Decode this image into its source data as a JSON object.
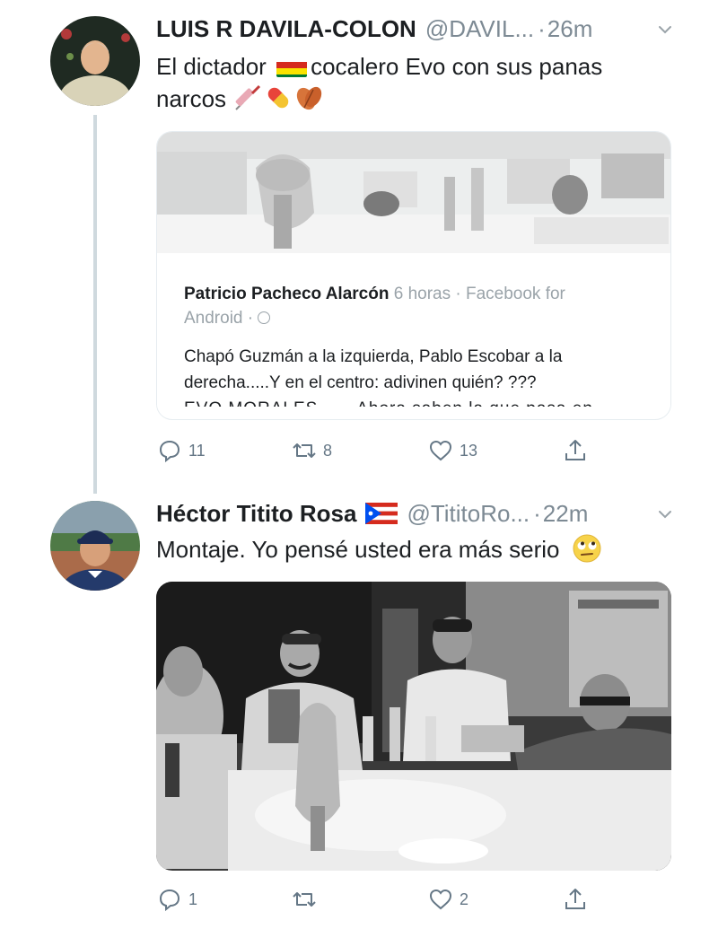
{
  "tweets": [
    {
      "display_name": "LUIS R DAVILA-COLON",
      "handle": "@DAVIL...",
      "dot": "·",
      "time": "26m",
      "text_before_flag": "El dictador",
      "text_after_flag": "cocalero Evo con sus panas",
      "text_line2": "narcos",
      "inline_icons": [
        "bolivia-flag-icon",
        "syringe-icon",
        "pill-icon",
        "coca-leaf-icon"
      ],
      "quoted_post": {
        "author": "Patricio Pacheco Alarcón",
        "meta": "6 horas · Facebook for",
        "meta_line2": "Android · ",
        "text_line1": "Chapó Guzmán a la izquierda, Pablo Escobar a la",
        "text_line2": "derecha.....Y en el centro: adivinen quién? ???",
        "text_line3": "EVO MORALES ..... Ahora saben la que pasa en"
      },
      "actions": {
        "replies": "11",
        "retweets": "8",
        "likes": "13"
      }
    },
    {
      "display_name": "Héctor Titito Rosa",
      "handle": "@TititoRo...",
      "dot": "·",
      "time": "22m",
      "text": "Montaje. Yo pensé usted era más serio",
      "inline_icons": [
        "puerto-rico-flag-icon",
        "eye-roll-emoji-icon"
      ],
      "actions": {
        "replies": "1",
        "retweets": "",
        "likes": "2"
      }
    }
  ],
  "colors": {
    "name": "#1c1f22",
    "meta_gray": "#7d8a94",
    "action_gray": "#657786",
    "thread_line": "#cfd9de"
  }
}
